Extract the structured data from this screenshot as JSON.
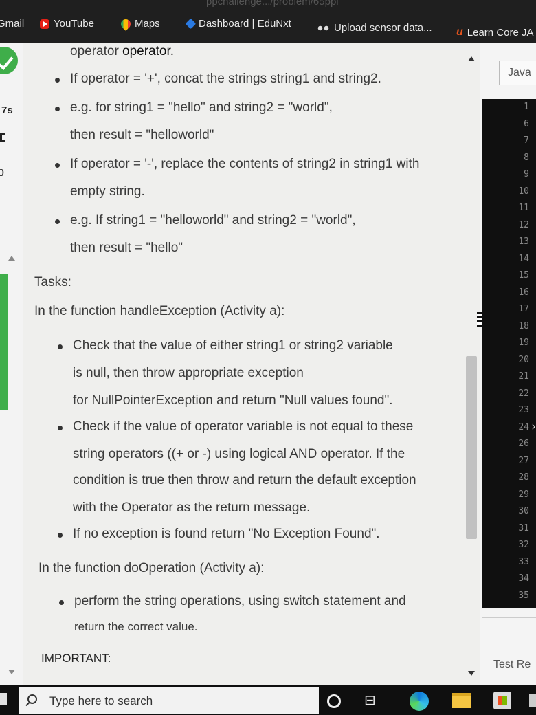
{
  "browser": {
    "url_fragment": "ppchallenge.../problem/65ppi",
    "bookmarks": [
      {
        "label": "Gmail"
      },
      {
        "label": "YouTube"
      },
      {
        "label": "Maps"
      },
      {
        "label": "Dashboard | EduNxt"
      },
      {
        "label": "Upload sensor data..."
      },
      {
        "label": "Learn Core JA"
      }
    ]
  },
  "left_panel": {
    "tag": "7s"
  },
  "problem": {
    "lines": [
      {
        "pre": "operator ",
        "bold": "operator.",
        "post": ""
      },
      {
        "text": "If operator = '+', concat the strings string1 and string2."
      },
      {
        "text": "e.g. for string1 = \"hello\" and string2 = \"world\","
      },
      {
        "text": "then result = \"helloworld\""
      },
      {
        "text": "If operator = '-', replace the contents of string2 in string1 with"
      },
      {
        "text": "empty string."
      },
      {
        "text": "e.g. If string1 = \"helloworld\" and string2 = \"world\","
      },
      {
        "text": "then result = \"hello\""
      }
    ],
    "tasks_heading": "Tasks:",
    "task_a_intro": "In the function handleException (Activity a):",
    "task_a_bullets": [
      "Check that the value of either string1 or string2 variable",
      "is null, then throw appropriate exception",
      "for NullPointerException and return \"Null values found\".",
      "Check if the value of operator variable is not equal to these",
      "string operators ((+ or -) using logical AND operator. If the",
      "condition is true then throw and return the default exception",
      "with the Operator as the return message.",
      "If no exception is found return \"No Exception Found\"."
    ],
    "task_b_intro": "In the function doOperation (Activity a):",
    "task_b_bullets": [
      "perform the string operations, using switch statement and",
      "return the correct value."
    ],
    "important": "IMPORTANT:"
  },
  "editor": {
    "language": "Java",
    "line_numbers": [
      "1",
      "6",
      "7",
      "8",
      "9",
      "10",
      "11",
      "12",
      "13",
      "14",
      "15",
      "16",
      "17",
      "18",
      "19",
      "20",
      "21",
      "22",
      "23",
      "24",
      "26",
      "27",
      "28",
      "29",
      "30",
      "31",
      "32",
      "33",
      "34",
      "35"
    ],
    "test_results_label": "Test Re"
  },
  "taskbar": {
    "search_placeholder": "Type here to search"
  }
}
